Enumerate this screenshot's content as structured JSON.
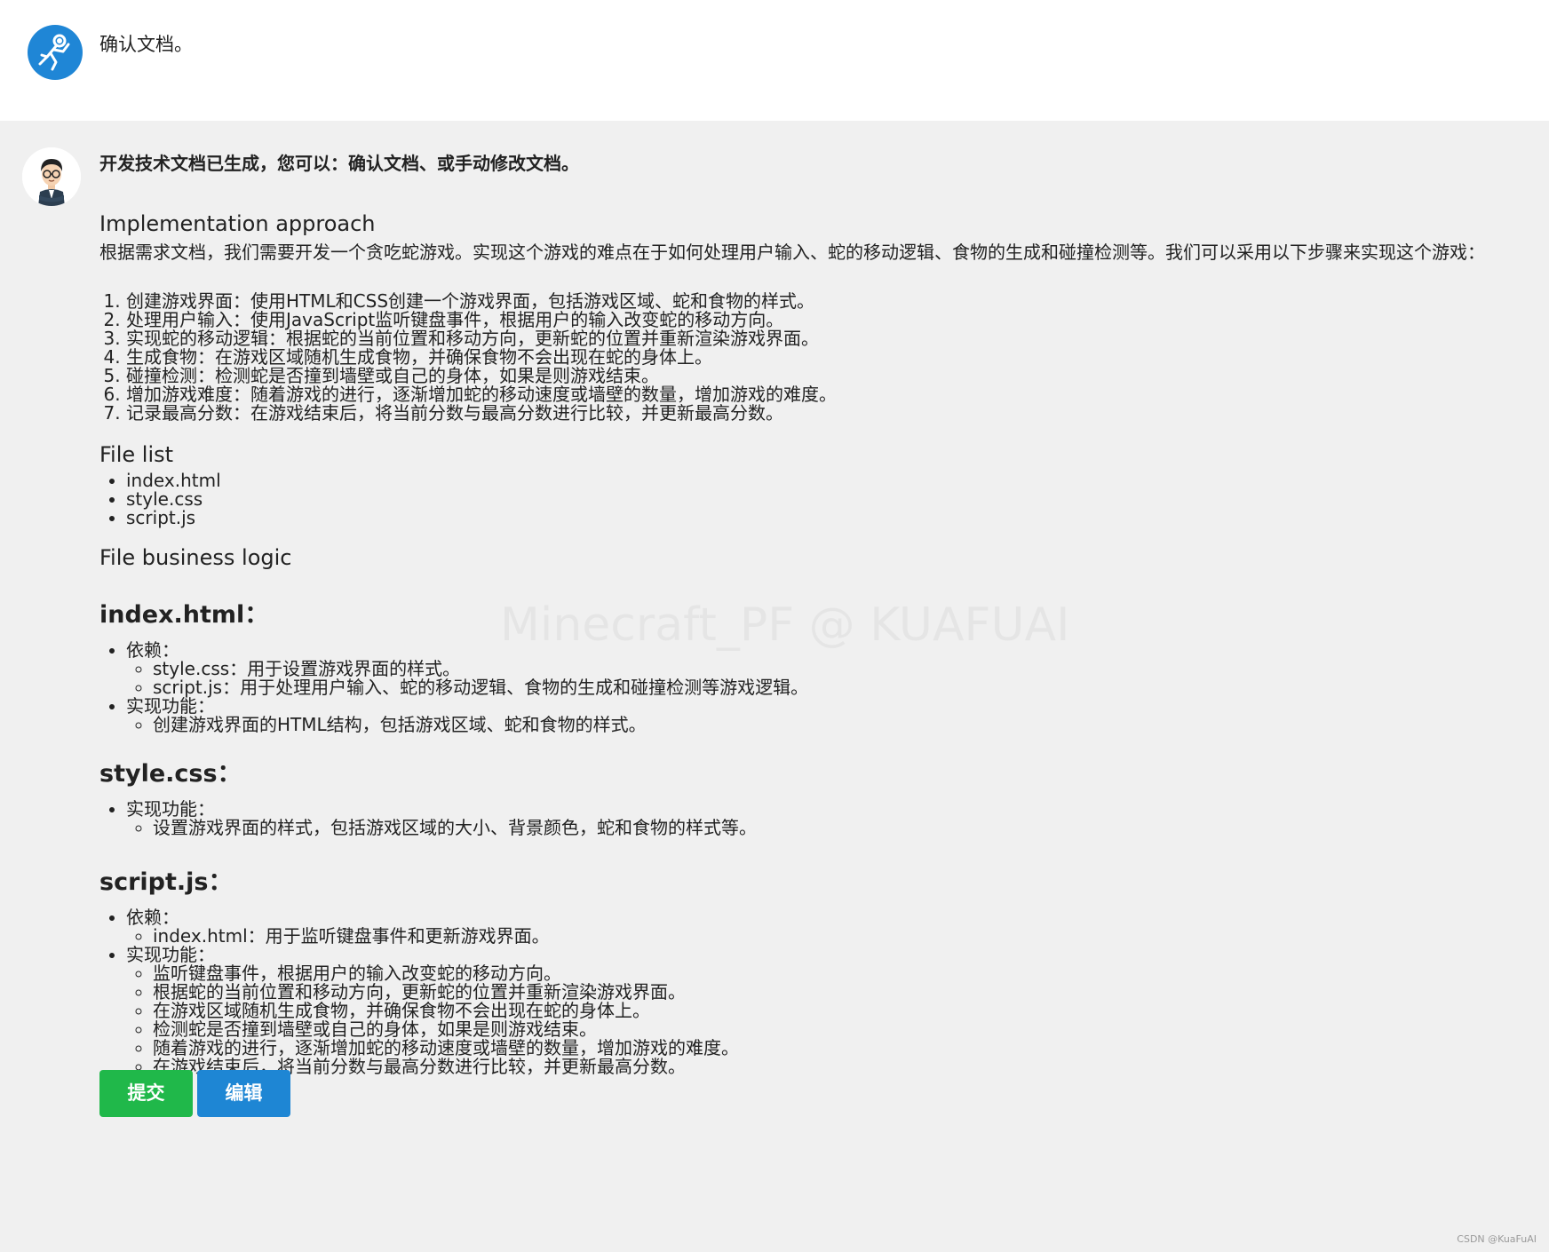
{
  "user_message": {
    "text": "确认文档。",
    "avatar_icon": "astronaut-icon",
    "avatar_color": "#1f86d6"
  },
  "bot_message": {
    "avatar_icon": "developer-avatar",
    "intro": "开发技术文档已生成，您可以：确认文档、或手动修改文档。",
    "approach_heading": "Implementation approach",
    "approach_text": "根据需求文档，我们需要开发一个贪吃蛇游戏。实现这个游戏的难点在于如何处理用户输入、蛇的移动逻辑、食物的生成和碰撞检测等。我们可以采用以下步骤来实现这个游戏：",
    "steps": [
      "创建游戏界面：使用HTML和CSS创建一个游戏界面，包括游戏区域、蛇和食物的样式。",
      "处理用户输入：使用JavaScript监听键盘事件，根据用户的输入改变蛇的移动方向。",
      "实现蛇的移动逻辑：根据蛇的当前位置和移动方向，更新蛇的位置并重新渲染游戏界面。",
      "生成食物：在游戏区域随机生成食物，并确保食物不会出现在蛇的身体上。",
      "碰撞检测：检测蛇是否撞到墙壁或自己的身体，如果是则游戏结束。",
      "增加游戏难度：随着游戏的进行，逐渐增加蛇的移动速度或墙壁的数量，增加游戏的难度。",
      "记录最高分数：在游戏结束后，将当前分数与最高分数进行比较，并更新最高分数。"
    ],
    "file_list_heading": "File list",
    "files": [
      "index.html",
      "style.css",
      "script.js"
    ],
    "business_logic_heading": "File business logic",
    "index_html": {
      "heading": "index.html：",
      "deps_label": "依赖：",
      "deps": [
        "style.css：用于设置游戏界面的样式。",
        "script.js：用于处理用户输入、蛇的移动逻辑、食物的生成和碰撞检测等游戏逻辑。"
      ],
      "func_label": "实现功能：",
      "funcs": [
        "创建游戏界面的HTML结构，包括游戏区域、蛇和食物的样式。"
      ]
    },
    "style_css": {
      "heading": "style.css：",
      "func_label": "实现功能：",
      "funcs": [
        "设置游戏界面的样式，包括游戏区域的大小、背景颜色，蛇和食物的样式等。"
      ]
    },
    "script_js": {
      "heading": "script.js：",
      "deps_label": "依赖：",
      "deps": [
        "index.html：用于监听键盘事件和更新游戏界面。"
      ],
      "func_label": "实现功能：",
      "funcs": [
        "监听键盘事件，根据用户的输入改变蛇的移动方向。",
        "根据蛇的当前位置和移动方向，更新蛇的位置并重新渲染游戏界面。",
        "在游戏区域随机生成食物，并确保食物不会出现在蛇的身体上。",
        "检测蛇是否撞到墙壁或自己的身体，如果是则游戏结束。",
        "随着游戏的进行，逐渐增加蛇的移动速度或墙壁的数量，增加游戏的难度。",
        "在游戏结束后，将当前分数与最高分数进行比较，并更新最高分数。"
      ]
    },
    "watermark": "Minecraft_PF @ KUAFUAI"
  },
  "buttons": {
    "submit_label": "提交",
    "submit_color": "#20b84a",
    "edit_label": "编辑",
    "edit_color": "#1e86d4"
  },
  "credit": "CSDN @KuaFuAI"
}
